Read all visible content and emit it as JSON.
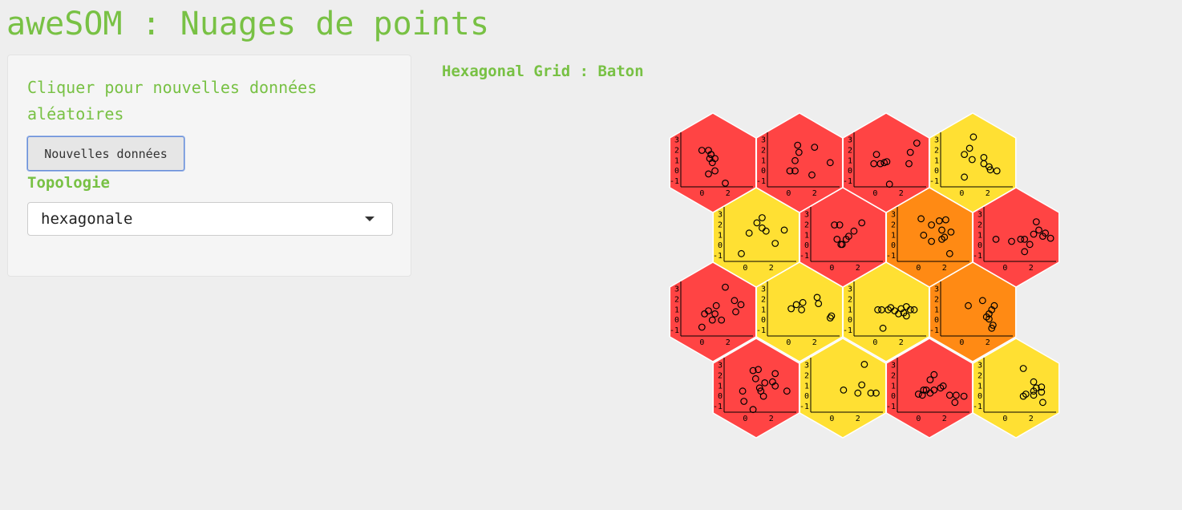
{
  "app": {
    "title": "aweSOM : Nuages de points"
  },
  "sidebar": {
    "help_text": "Cliquer pour nouvelles données aléatoires",
    "new_data_button": "Nouvelles données",
    "topology_label": "Topologie",
    "topology_select": {
      "selected": "hexagonale"
    }
  },
  "plot": {
    "title": "Hexagonal Grid : Baton",
    "colors": {
      "red": "#ff4444",
      "yellow": "#ffe033",
      "orange": "#ff8a14",
      "cell_border": "#ffffff"
    }
  },
  "chart_data": {
    "type": "scatter",
    "grid": {
      "rows": 4,
      "cols": 4,
      "topology": "hexagonal"
    },
    "x_ticks": [
      "0",
      "2"
    ],
    "y_ticks": [
      "3",
      "2",
      "1",
      "0",
      "-1"
    ],
    "xlim": [
      -1.5,
      3.8
    ],
    "ylim": [
      -1.4,
      3.6
    ],
    "cells": [
      {
        "row": 0,
        "col": 0,
        "color": "red",
        "points": [
          [
            0,
            2
          ],
          [
            0.5,
            2
          ],
          [
            0.7,
            1.6
          ],
          [
            0.6,
            1.2
          ],
          [
            1,
            1.2
          ],
          [
            0.8,
            0.8
          ],
          [
            1,
            0
          ],
          [
            0.5,
            -0.3
          ],
          [
            1.8,
            -1.2
          ],
          [
            0.7,
            1.6
          ]
        ]
      },
      {
        "row": 0,
        "col": 1,
        "color": "red",
        "points": [
          [
            0.7,
            2.5
          ],
          [
            2,
            2.3
          ],
          [
            0.8,
            1.8
          ],
          [
            0.5,
            1
          ],
          [
            0.1,
            0
          ],
          [
            0.5,
            0
          ],
          [
            1.8,
            -0.4
          ],
          [
            3.2,
            0.8
          ]
        ]
      },
      {
        "row": 0,
        "col": 2,
        "color": "red",
        "points": [
          [
            3.2,
            2.7
          ],
          [
            2.7,
            1.8
          ],
          [
            0.1,
            1.6
          ],
          [
            -0.1,
            0.7
          ],
          [
            0.4,
            0.7
          ],
          [
            0.9,
            0.9
          ],
          [
            0.7,
            0.8
          ],
          [
            2.6,
            0.7
          ],
          [
            1.1,
            -1.3
          ]
        ]
      },
      {
        "row": 0,
        "col": 3,
        "color": "yellow",
        "points": [
          [
            0.9,
            3.3
          ],
          [
            0.6,
            2.2
          ],
          [
            0.2,
            1.6
          ],
          [
            0.8,
            1.1
          ],
          [
            1.7,
            1.3
          ],
          [
            1.7,
            0.7
          ],
          [
            2.1,
            0.4
          ],
          [
            2.2,
            0.1
          ],
          [
            2.7,
            0
          ],
          [
            0.2,
            -0.6
          ]
        ]
      },
      {
        "row": 1,
        "col": 0,
        "color": "yellow",
        "points": [
          [
            1.3,
            2.7
          ],
          [
            0.9,
            2.2
          ],
          [
            1.3,
            1.7
          ],
          [
            1.6,
            1.4
          ],
          [
            0.3,
            1.2
          ],
          [
            3,
            1.5
          ],
          [
            2.3,
            0.2
          ],
          [
            -0.3,
            -0.8
          ]
        ]
      },
      {
        "row": 1,
        "col": 1,
        "color": "red",
        "points": [
          [
            0.2,
            2
          ],
          [
            0.6,
            2
          ],
          [
            2.3,
            2.2
          ],
          [
            1.7,
            1.4
          ],
          [
            1.3,
            0.9
          ],
          [
            1.1,
            0.6
          ],
          [
            0.4,
            0.6
          ],
          [
            0.7,
            0.1
          ],
          [
            0.8,
            0.1
          ]
        ]
      },
      {
        "row": 1,
        "col": 2,
        "color": "orange",
        "points": [
          [
            0.2,
            2.6
          ],
          [
            1.6,
            2.4
          ],
          [
            2.1,
            2.5
          ],
          [
            1,
            2
          ],
          [
            1.8,
            1.5
          ],
          [
            0.4,
            1
          ],
          [
            2.5,
            1.3
          ],
          [
            2,
            0.8
          ],
          [
            1.8,
            0.6
          ],
          [
            1,
            0.4
          ],
          [
            2.4,
            -0.8
          ]
        ]
      },
      {
        "row": 1,
        "col": 3,
        "color": "red",
        "points": [
          [
            2.4,
            2.3
          ],
          [
            2.6,
            1.5
          ],
          [
            3.1,
            1.2
          ],
          [
            2.2,
            1.1
          ],
          [
            2.9,
            0.9
          ],
          [
            1.2,
            0.6
          ],
          [
            1.5,
            0.6
          ],
          [
            3.5,
            0.7
          ],
          [
            0.5,
            0.4
          ],
          [
            1.9,
            0.1
          ],
          [
            1.5,
            -0.6
          ],
          [
            -0.7,
            0.6
          ]
        ]
      },
      {
        "row": 2,
        "col": 0,
        "color": "red",
        "points": [
          [
            1.8,
            3.2
          ],
          [
            2.5,
            1.9
          ],
          [
            3,
            1.5
          ],
          [
            1.1,
            1.4
          ],
          [
            2.6,
            0.8
          ],
          [
            0.5,
            0.9
          ],
          [
            0.2,
            0.6
          ],
          [
            1,
            0.6
          ],
          [
            0.8,
            0
          ],
          [
            1.5,
            0
          ],
          [
            0,
            -0.7
          ]
        ]
      },
      {
        "row": 2,
        "col": 1,
        "color": "yellow",
        "points": [
          [
            2.2,
            2.2
          ],
          [
            1.1,
            1.7
          ],
          [
            2.3,
            1.6
          ],
          [
            0.6,
            1.5
          ],
          [
            0.2,
            1.1
          ],
          [
            1,
            1
          ],
          [
            3.3,
            0.4
          ],
          [
            3.2,
            0.2
          ]
        ]
      },
      {
        "row": 2,
        "col": 2,
        "color": "yellow",
        "points": [
          [
            0.2,
            1
          ],
          [
            0.5,
            1
          ],
          [
            1,
            1
          ],
          [
            1.2,
            1.2
          ],
          [
            1.5,
            0.9
          ],
          [
            2,
            1.1
          ],
          [
            2.4,
            1.3
          ],
          [
            2.7,
            1
          ],
          [
            3,
            1
          ],
          [
            2.2,
            0.7
          ],
          [
            1.8,
            0.6
          ],
          [
            2.4,
            0.4
          ],
          [
            0.6,
            -0.8
          ]
        ]
      },
      {
        "row": 2,
        "col": 3,
        "color": "orange",
        "points": [
          [
            1.6,
            1.9
          ],
          [
            0.5,
            1.4
          ],
          [
            2.5,
            1.4
          ],
          [
            2.3,
            1
          ],
          [
            2.1,
            0.6
          ],
          [
            1.9,
            0.3
          ],
          [
            2.1,
            0.1
          ],
          [
            2.3,
            -0.8
          ],
          [
            2.4,
            -0.5
          ]
        ]
      },
      {
        "row": 3,
        "col": 0,
        "color": "red",
        "points": [
          [
            0.6,
            2.5
          ],
          [
            1,
            2.6
          ],
          [
            2.3,
            2.2
          ],
          [
            0.8,
            1.7
          ],
          [
            1.5,
            1.3
          ],
          [
            2.1,
            1.4
          ],
          [
            2.3,
            1
          ],
          [
            1.1,
            0.8
          ],
          [
            3.2,
            0.5
          ],
          [
            -0.2,
            0.5
          ],
          [
            -0.1,
            -0.5
          ],
          [
            0.6,
            -1.3
          ],
          [
            1.2,
            0.5
          ],
          [
            1.4,
            0
          ]
        ]
      },
      {
        "row": 3,
        "col": 1,
        "color": "yellow",
        "points": [
          [
            2.5,
            3.1
          ],
          [
            2.3,
            1.1
          ],
          [
            0.9,
            0.6
          ],
          [
            2,
            0.3
          ],
          [
            3,
            0.3
          ],
          [
            3.4,
            0.3
          ]
        ]
      },
      {
        "row": 3,
        "col": 2,
        "color": "red",
        "points": [
          [
            1.2,
            2.1
          ],
          [
            0.9,
            1.6
          ],
          [
            1.9,
            1
          ],
          [
            1.7,
            0.8
          ],
          [
            1.2,
            0.6
          ],
          [
            0.9,
            0.3
          ],
          [
            0,
            0.2
          ],
          [
            0.3,
            0.1
          ],
          [
            2.4,
            0.1
          ],
          [
            2.9,
            0.1
          ],
          [
            3.5,
            0
          ],
          [
            2.8,
            -0.6
          ],
          [
            0.4,
            0.6
          ],
          [
            0.6,
            0.6
          ]
        ]
      },
      {
        "row": 3,
        "col": 3,
        "color": "yellow",
        "points": [
          [
            1.4,
            2.7
          ],
          [
            2.2,
            1.4
          ],
          [
            2.8,
            0.9
          ],
          [
            2.4,
            0.8
          ],
          [
            2.2,
            0.5
          ],
          [
            2.8,
            0.4
          ],
          [
            2.2,
            0.1
          ],
          [
            1.4,
            0
          ],
          [
            1.6,
            0.2
          ],
          [
            2.9,
            -0.6
          ]
        ]
      }
    ]
  }
}
